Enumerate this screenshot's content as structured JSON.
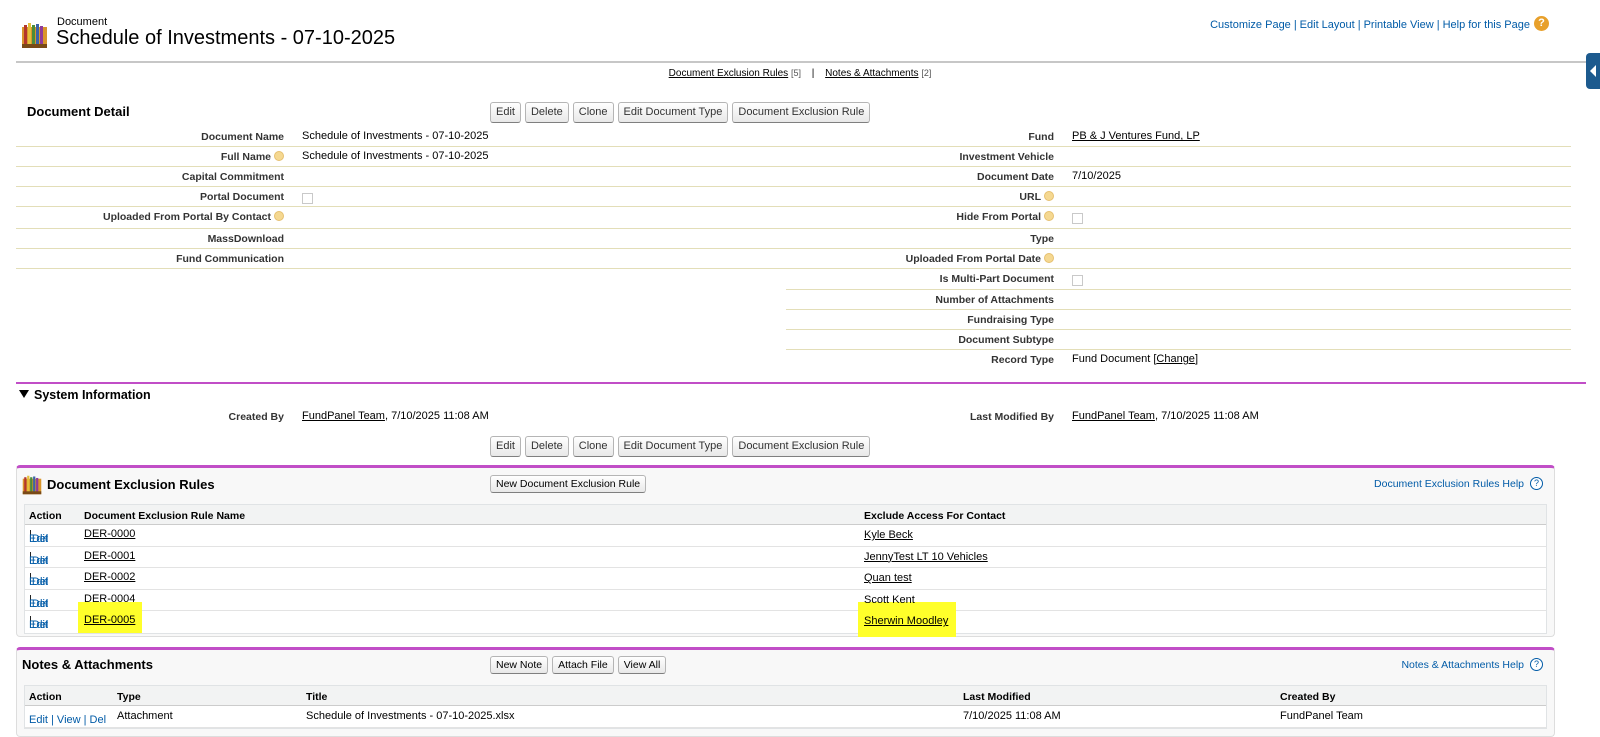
{
  "header": {
    "object_label": "Document",
    "title": "Schedule of Investments - 07-10-2025",
    "links": [
      "Customize Page",
      "Edit Layout",
      "Printable View",
      "Help for this Page"
    ],
    "help_icon_glyph": "?"
  },
  "related_hover_links": [
    {
      "label": "Document Exclusion Rules",
      "count": "[5]"
    },
    {
      "label": "Notes & Attachments",
      "count": "[2]"
    }
  ],
  "detail": {
    "title": "Document Detail",
    "buttons": [
      "Edit",
      "Delete",
      "Clone",
      "Edit Document Type",
      "Document Exclusion Rule"
    ],
    "left_fields": [
      {
        "label": "Document Name",
        "value": "Schedule of Investments - 07-10-2025"
      },
      {
        "label": "Full Name",
        "value": "Schedule of Investments - 07-10-2025"
      },
      {
        "label": "Capital Commitment",
        "value": ""
      },
      {
        "label": "Portal Document",
        "value": ""
      },
      {
        "label": "Uploaded From Portal By Contact",
        "value": ""
      },
      {
        "label": "MassDownload",
        "value": ""
      },
      {
        "label": "Fund Communication",
        "value": ""
      }
    ],
    "right_fields": [
      {
        "label": "Fund",
        "value": "PB & J Ventures Fund, LP"
      },
      {
        "label": "Investment Vehicle",
        "value": ""
      },
      {
        "label": "Document Date",
        "value": "7/10/2025"
      },
      {
        "label": "URL",
        "value": ""
      },
      {
        "label": "Hide From Portal",
        "value": ""
      },
      {
        "label": "Type",
        "value": ""
      },
      {
        "label": "Uploaded From Portal Date",
        "value": ""
      },
      {
        "label": "Is Multi-Part Document",
        "value": ""
      },
      {
        "label": "Number of Attachments",
        "value": ""
      },
      {
        "label": "Fundraising Type",
        "value": ""
      },
      {
        "label": "Document Subtype",
        "value": ""
      },
      {
        "label": "Record Type",
        "value": "Fund Document",
        "change_label": "Change"
      }
    ]
  },
  "system_info": {
    "title": "System Information",
    "created_by_label": "Created By",
    "created_by_user": "FundPanel Team",
    "created_by_date": ", 7/10/2025 11:08 AM",
    "modified_by_label": "Last Modified By",
    "modified_by_user": "FundPanel Team",
    "modified_by_date": ", 7/10/2025 11:08 AM"
  },
  "exclusion_rules": {
    "title": "Document Exclusion Rules",
    "new_button": "New Document Exclusion Rule",
    "help_link": "Document Exclusion Rules Help",
    "columns": [
      "Action",
      "Document Exclusion Rule Name",
      "Exclude Access For Contact"
    ],
    "action_edit": "Edit",
    "action_del": "Del",
    "rows": [
      {
        "name": "DER-0000",
        "contact": "Kyle Beck"
      },
      {
        "name": "DER-0001",
        "contact": "JennyTest LT 10 Vehicles"
      },
      {
        "name": "DER-0002",
        "contact": "Quan test"
      },
      {
        "name": "DER-0004",
        "contact": "Scott Kent"
      },
      {
        "name": "DER-0005",
        "contact": "Sherwin Moodley"
      }
    ],
    "highlight_color": "#ffff00"
  },
  "notes": {
    "title": "Notes & Attachments",
    "buttons": [
      "New Note",
      "Attach File",
      "View All"
    ],
    "help_link": "Notes & Attachments Help",
    "columns": [
      "Action",
      "Type",
      "Title",
      "Last Modified",
      "Created By"
    ],
    "rows": [
      {
        "actions": "Edit | View | Del",
        "type": "Attachment",
        "title": "Schedule of Investments - 07-10-2025.xlsx",
        "modified": "7/10/2025 11:08 AM",
        "created_by": "FundPanel Team"
      }
    ]
  },
  "colors": {
    "accent_purple": "#c14ec7",
    "link_blue": "#015ba7",
    "help_orange": "#e8a02b"
  }
}
